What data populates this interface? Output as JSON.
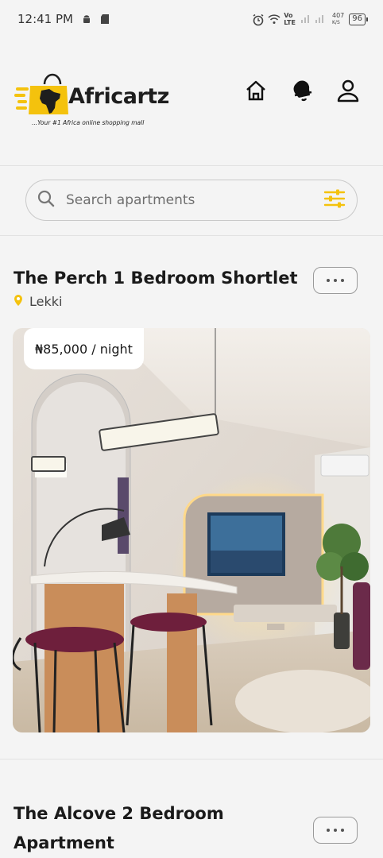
{
  "status_bar": {
    "time": "12:41 PM",
    "network_label_top": "Vo",
    "network_label_bottom": "LTE",
    "speed_value": "407",
    "speed_unit": "K/S",
    "battery": "96"
  },
  "brand": {
    "name": "Africartz",
    "tagline": "...Your #1 Africa online  shopping mall",
    "accent_color": "#f4c20d"
  },
  "search": {
    "placeholder": "Search apartments"
  },
  "listings": [
    {
      "title": "The Perch 1 Bedroom Shortlet",
      "location": "Lekki",
      "price": "₦85,000 / night"
    },
    {
      "title": "The Alcove 2 Bedroom Apartment"
    }
  ]
}
